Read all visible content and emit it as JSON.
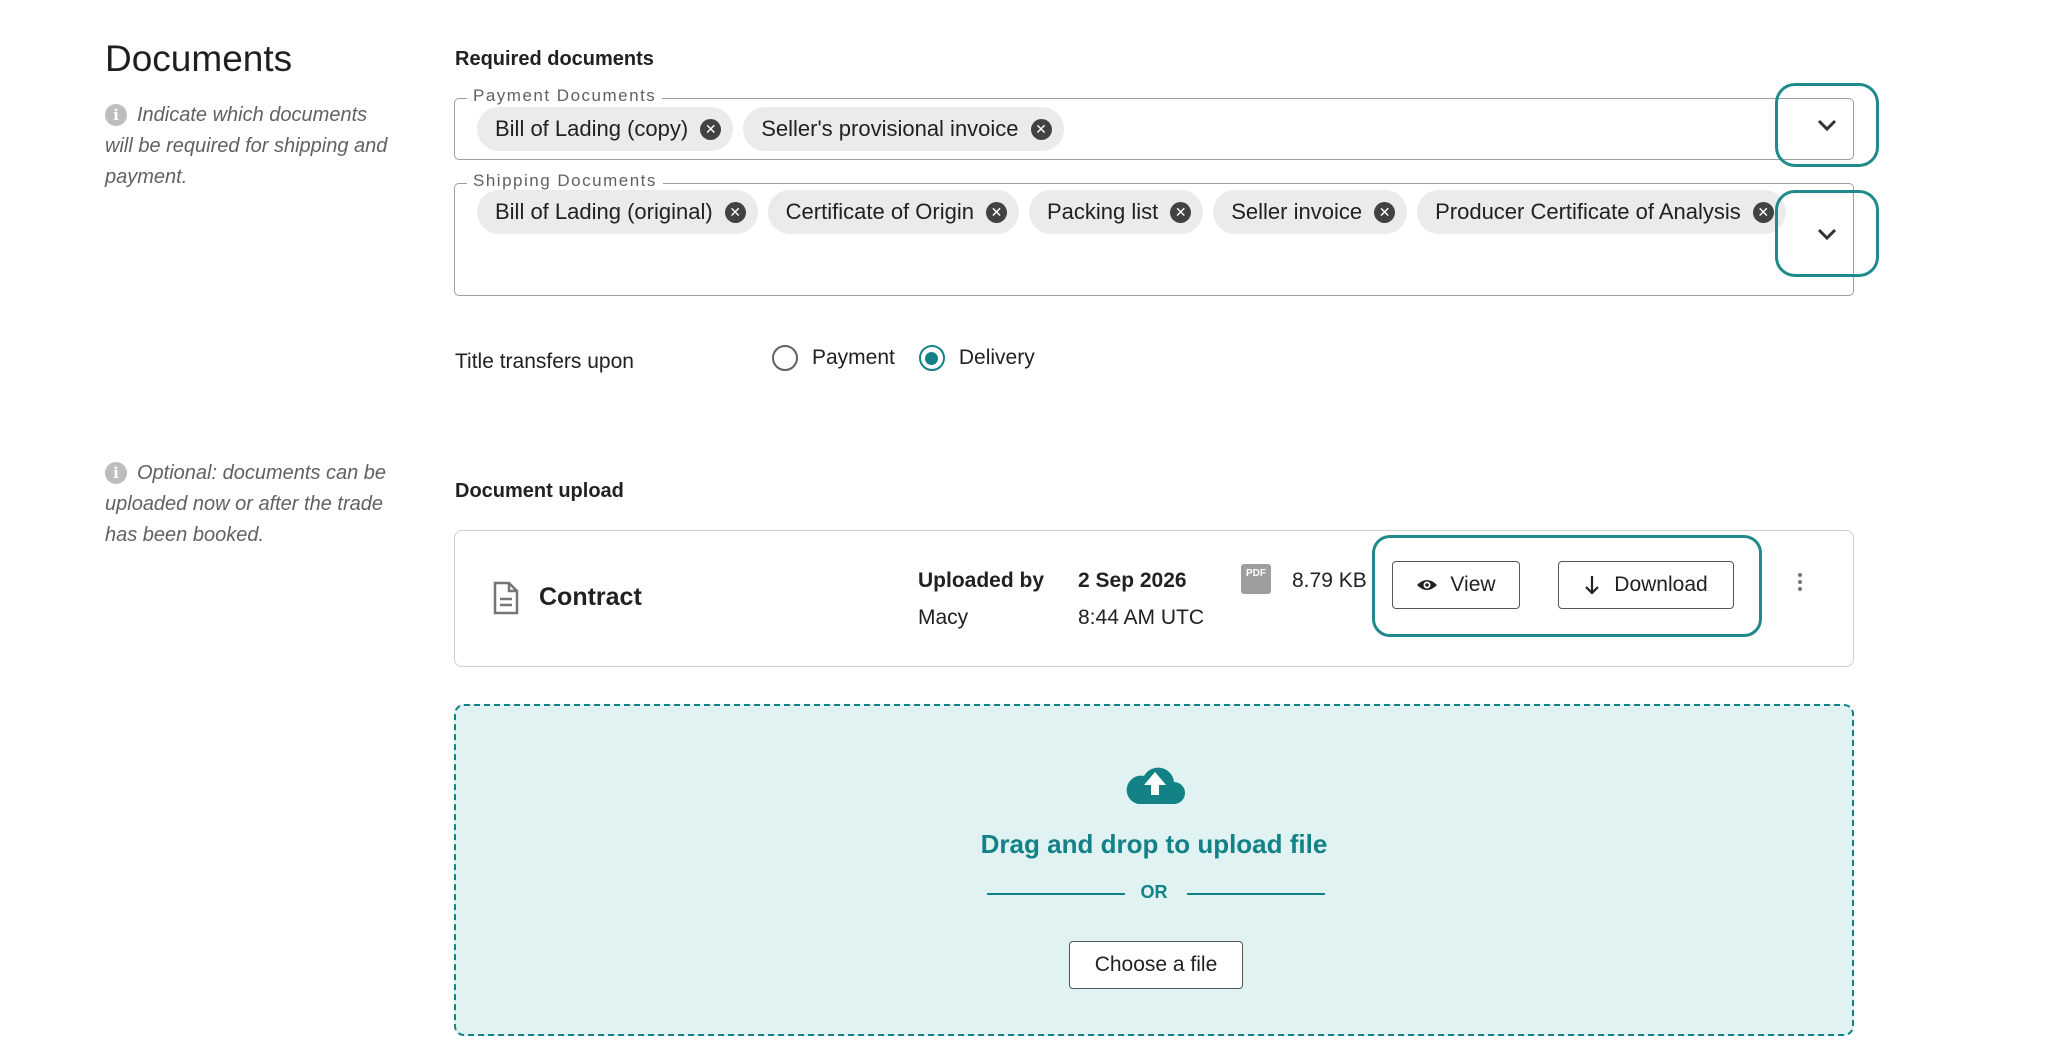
{
  "header": {
    "title": "Documents",
    "note_required": "Indicate which documents will be required for shipping and payment.",
    "note_optional": "Optional: documents can be uploaded now or after the trade has been booked."
  },
  "required": {
    "label": "Required documents",
    "payment": {
      "legend": "Payment Documents",
      "chips": [
        "Bill of Lading (copy)",
        "Seller's provisional invoice"
      ]
    },
    "shipping": {
      "legend": "Shipping Documents",
      "chips": [
        "Bill of Lading (original)",
        "Certificate of Origin",
        "Packing list",
        "Seller invoice",
        "Producer Certificate of Analysis"
      ]
    }
  },
  "title_transfer": {
    "label": "Title transfers upon",
    "options": [
      "Payment",
      "Delivery"
    ],
    "selected": "Delivery"
  },
  "upload": {
    "label": "Document upload",
    "file": {
      "name": "Contract",
      "uploaded_by_label": "Uploaded by",
      "uploaded_by": "Macy",
      "date": "2 Sep 2026",
      "time": "8:44 AM UTC",
      "file_type": "PDF",
      "size": "8.79 KB",
      "view_label": "View",
      "download_label": "Download"
    },
    "drop": {
      "title": "Drag and drop to upload file",
      "or": "OR",
      "choose_label": "Choose a file"
    }
  },
  "colors": {
    "accent": "#128286",
    "drop_bg": "#e0f2f1"
  }
}
